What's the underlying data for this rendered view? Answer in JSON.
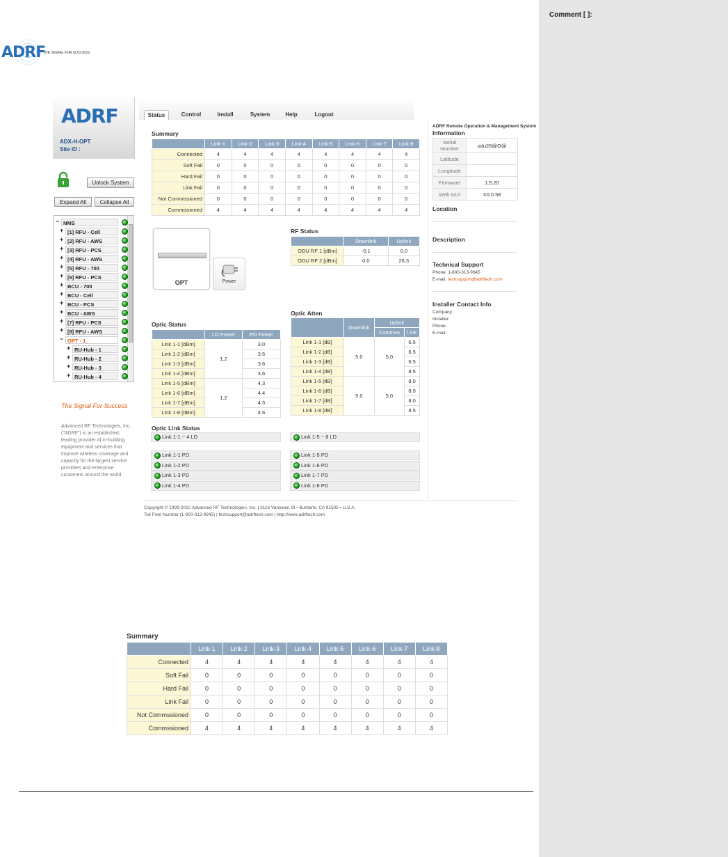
{
  "doc": {
    "logo_text": "ADRF",
    "logo_tagline": "THE SIGNAL FOR SUCCESS",
    "comment_label": "Comment [ ]:"
  },
  "app": {
    "sidebar": {
      "logo_text": "ADRF",
      "device": "ADX-H-OPT",
      "site": "Site ID :",
      "unlock_label": "Unlock System",
      "expand_label": "Expand All",
      "collapse_label": "Collapse All",
      "tree": [
        {
          "pm": "−",
          "label": "NMS",
          "level": 0
        },
        {
          "pm": "+",
          "label": "[1] RFU - Cell",
          "level": 1
        },
        {
          "pm": "+",
          "label": "[2] RFU - AWS",
          "level": 1
        },
        {
          "pm": "+",
          "label": "[3] RFU - PCS",
          "level": 1
        },
        {
          "pm": "+",
          "label": "[4] RFU - AWS",
          "level": 1
        },
        {
          "pm": "+",
          "label": "[5] RFU - 700",
          "level": 1
        },
        {
          "pm": "+",
          "label": "[6] RFU - PCS",
          "level": 1
        },
        {
          "pm": "+",
          "label": "BCU - 700",
          "level": 1
        },
        {
          "pm": "+",
          "label": "BCU - Cell",
          "level": 1
        },
        {
          "pm": "+",
          "label": "BCU - PCS",
          "level": 1
        },
        {
          "pm": "+",
          "label": "BCU - AWS",
          "level": 1
        },
        {
          "pm": "+",
          "label": "[7] RFU - PCS",
          "level": 1
        },
        {
          "pm": "+",
          "label": "[8] RFU - AWS",
          "level": 1
        },
        {
          "pm": "−",
          "label": "OPT - 1",
          "level": 1,
          "selected": true
        },
        {
          "pm": "+",
          "label": "RU-Hub - 1",
          "level": 2
        },
        {
          "pm": "+",
          "label": "RU-Hub - 2",
          "level": 2
        },
        {
          "pm": "+",
          "label": "RU-Hub - 3",
          "level": 2
        },
        {
          "pm": "+",
          "label": "RU-Hub - 4",
          "level": 2
        }
      ],
      "tagline": "The Signal For Success",
      "about": "Advanced RF Technologies, Inc. (\"ADRF\") is an established, leading provider of in-building equipment and services that improve wireless coverage and capacity for the largest service providers and enterprise customers around the world."
    },
    "tabs": [
      "Status",
      "Control",
      "Install",
      "System",
      "Help",
      "Logout"
    ],
    "summary": {
      "title": "Summary",
      "columns": [
        "Link-1",
        "Link-2",
        "Link-3",
        "Link-4",
        "Link-5",
        "Link-6",
        "Link-7",
        "Link-8"
      ],
      "rows": [
        {
          "label": "Connected",
          "values": [
            "4",
            "4",
            "4",
            "4",
            "4",
            "4",
            "4",
            "4"
          ]
        },
        {
          "label": "Soft Fail",
          "values": [
            "0",
            "0",
            "0",
            "0",
            "0",
            "0",
            "0",
            "0"
          ]
        },
        {
          "label": "Hard Fail",
          "values": [
            "0",
            "0",
            "0",
            "0",
            "0",
            "0",
            "0",
            "0"
          ]
        },
        {
          "label": "Link Fail",
          "values": [
            "0",
            "0",
            "0",
            "0",
            "0",
            "0",
            "0",
            "0"
          ]
        },
        {
          "label": "Not Commissioned",
          "values": [
            "0",
            "0",
            "0",
            "0",
            "0",
            "0",
            "0",
            "0"
          ]
        },
        {
          "label": "Commissioned",
          "values": [
            "4",
            "4",
            "4",
            "4",
            "4",
            "4",
            "4",
            "4"
          ]
        }
      ]
    },
    "device_panel": {
      "name": "OPT",
      "power_label": "Power"
    },
    "rf_status": {
      "title": "RF Status",
      "columns": [
        "Downlink",
        "Uplink"
      ],
      "rows": [
        {
          "label": "ODU RF 1 [dBm]",
          "values": [
            "-0.1",
            "0.0"
          ]
        },
        {
          "label": "ODU RF 2 [dBm]",
          "values": [
            "0.0",
            "26.3"
          ]
        }
      ]
    },
    "optic_status": {
      "title": "Optic Status",
      "columns": [
        "LD Power",
        "PD Power"
      ],
      "ld_groups": [
        "1.2",
        "1.2"
      ],
      "rows": [
        {
          "label": "Link 1-1 [dBm]",
          "pd": "3.0"
        },
        {
          "label": "Link 1-2 [dBm]",
          "pd": "3.5"
        },
        {
          "label": "Link 1-3 [dBm]",
          "pd": "3.6"
        },
        {
          "label": "Link 1-4 [dBm]",
          "pd": "3.6"
        },
        {
          "label": "Link 1-5 [dBm]",
          "pd": "4.3"
        },
        {
          "label": "Link 1-6 [dBm]",
          "pd": "4.4"
        },
        {
          "label": "Link 1-7 [dBm]",
          "pd": "4.3"
        },
        {
          "label": "Link 1-8 [dBm]",
          "pd": "4.6"
        }
      ]
    },
    "optic_atten": {
      "title": "Optic Atten",
      "columns": {
        "downlink": "Downlink",
        "uplink": "Uplink",
        "common": "Common",
        "link": "Link"
      },
      "groups": [
        {
          "downlink": "5.0",
          "common": "5.0"
        },
        {
          "downlink": "5.0",
          "common": "5.0"
        }
      ],
      "rows": [
        {
          "label": "Link 1-1 [dB]",
          "link": "6.5"
        },
        {
          "label": "Link 1-2 [dB]",
          "link": "6.5"
        },
        {
          "label": "Link 1-3 [dB]",
          "link": "6.5"
        },
        {
          "label": "Link 1-4 [dB]",
          "link": "8.5"
        },
        {
          "label": "Link 1-5 [dB]",
          "link": "8.0"
        },
        {
          "label": "Link 1-6 [dB]",
          "link": "8.0"
        },
        {
          "label": "Link 1-7 [dB]",
          "link": "8.0"
        },
        {
          "label": "Link 1-8 [dB]",
          "link": "8.5"
        }
      ]
    },
    "optic_link_status": {
      "title": "Optic Link Status",
      "ld_left": "Link 1-1 ~ 4 LD",
      "ld_right": "Link 1-5 ~ 8 LD",
      "pd_left": [
        "Link 1-1 PD",
        "Link 1-2 PD",
        "Link 1-3 PD",
        "Link 1-4 PD"
      ],
      "pd_right": [
        "Link 1-5 PD",
        "Link 1-6 PD",
        "Link 1-7 PD",
        "Link 1-8 PD"
      ]
    },
    "info": {
      "system_title": "ADRF Remote Operation & Management System",
      "title": "Information",
      "rows": [
        {
          "label": "Serial Number",
          "value": "odu26@O@"
        },
        {
          "label": "Latitude",
          "value": ""
        },
        {
          "label": "Longitude",
          "value": ""
        },
        {
          "label": "Firmware",
          "value": "1.5.20"
        },
        {
          "label": "Web GUI",
          "value": "X0.0.58"
        }
      ],
      "location": "Location",
      "description": "Description",
      "support_title": "Technical Support",
      "support_phone": "Phone: 1-800-313-9345",
      "support_email_label": "E-mail:",
      "support_email": "techsupport@adrftech.com",
      "installer_title": "Installer Contact Info",
      "installer_lines": [
        "Company:",
        "Installer:",
        "Phone:",
        "E-mail:"
      ]
    },
    "footer": {
      "line1": "Copyright © 1999-2010 Advanced RF Technologies, Inc. | 3116 Vanowen St • Burbank, CA 91505 • U.S.A.",
      "line2": "Toll Free Number (1-800-313-9345) | techsupport@adrftech.com | http://www.adrftech.com"
    }
  },
  "zoom_summary": {
    "title": "Summary",
    "columns": [
      "Link-1",
      "Link-2",
      "Link-3",
      "Link-4",
      "Link-5",
      "Link-6",
      "Link-7",
      "Link-8"
    ],
    "rows": [
      {
        "label": "Connected",
        "values": [
          "4",
          "4",
          "4",
          "4",
          "4",
          "4",
          "4",
          "4"
        ]
      },
      {
        "label": "Soft Fail",
        "values": [
          "0",
          "0",
          "0",
          "0",
          "0",
          "0",
          "0",
          "0"
        ]
      },
      {
        "label": "Hard Fail",
        "values": [
          "0",
          "0",
          "0",
          "0",
          "0",
          "0",
          "0",
          "0"
        ]
      },
      {
        "label": "Link Fail",
        "values": [
          "0",
          "0",
          "0",
          "0",
          "0",
          "0",
          "0",
          "0"
        ]
      },
      {
        "label": "Not Commssioned",
        "values": [
          "0",
          "0",
          "0",
          "0",
          "0",
          "0",
          "0",
          "0"
        ]
      },
      {
        "label": "Commssioned",
        "values": [
          "4",
          "4",
          "4",
          "4",
          "4",
          "4",
          "4",
          "4"
        ]
      }
    ]
  }
}
